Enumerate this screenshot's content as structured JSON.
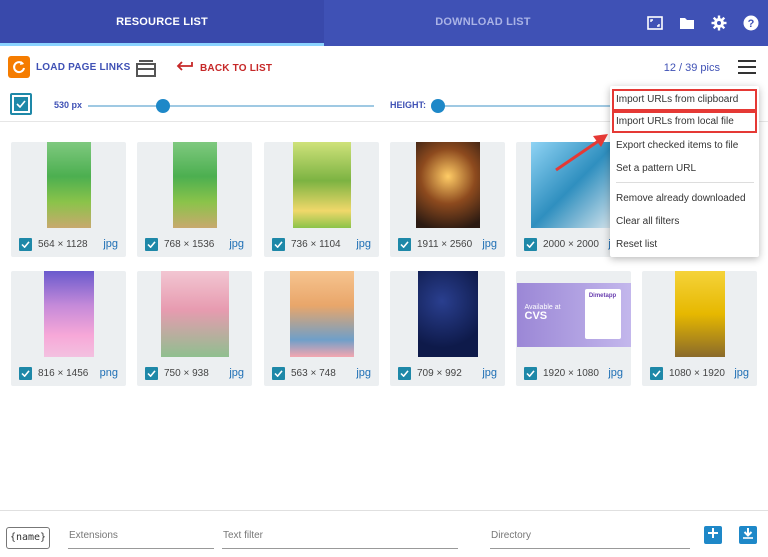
{
  "tabs": {
    "resource": "RESOURCE LIST",
    "download": "DOWNLOAD LIST"
  },
  "toolbar": {
    "load_label": "LOAD PAGE LINKS",
    "back_label": "BACK TO LIST",
    "count": "12 / 39 pics"
  },
  "sliders": {
    "width_label": "530 px",
    "height_label": "HEIGHT:"
  },
  "menu": {
    "items": [
      "Import URLs from clipboard",
      "Import URLs from local file",
      "Export checked items to file",
      "Set a pattern URL",
      "Remove already downloaded",
      "Clear all filters",
      "Reset list"
    ]
  },
  "grid": [
    {
      "dims": "564 × 1128",
      "ext": "jpg"
    },
    {
      "dims": "768 × 1536",
      "ext": "jpg"
    },
    {
      "dims": "736 × 1104",
      "ext": "jpg"
    },
    {
      "dims": "1911 × 2560",
      "ext": "jpg"
    },
    {
      "dims": "2000 × 2000",
      "ext": "jpg"
    },
    {
      "dims": "",
      "ext": ""
    },
    {
      "dims": "816 × 1456",
      "ext": "png"
    },
    {
      "dims": "750 × 938",
      "ext": "jpg"
    },
    {
      "dims": "563 × 748",
      "ext": "jpg"
    },
    {
      "dims": "709 × 992",
      "ext": "jpg"
    },
    {
      "dims": "1920 × 1080",
      "ext": "jpg"
    },
    {
      "dims": "1080 × 1920",
      "ext": "jpg"
    }
  ],
  "ad": {
    "line1": "Available at",
    "brand": "CVS",
    "product": "Dimetapp"
  },
  "bottom": {
    "name_tag": "{name}",
    "extensions_placeholder": "Extensions",
    "text_filter_placeholder": "Text filter",
    "directory_placeholder": "Directory"
  },
  "colors": {
    "topbar": "#3f51b5",
    "accent": "#1e88c8",
    "highlight_border": "#e53935"
  },
  "icons": [
    "reload-icon",
    "layers-icon",
    "back-arrow-icon",
    "hamburger-icon",
    "fullscreen-icon",
    "folder-icon",
    "gear-icon",
    "help-icon",
    "plus-icon",
    "download-icon"
  ]
}
